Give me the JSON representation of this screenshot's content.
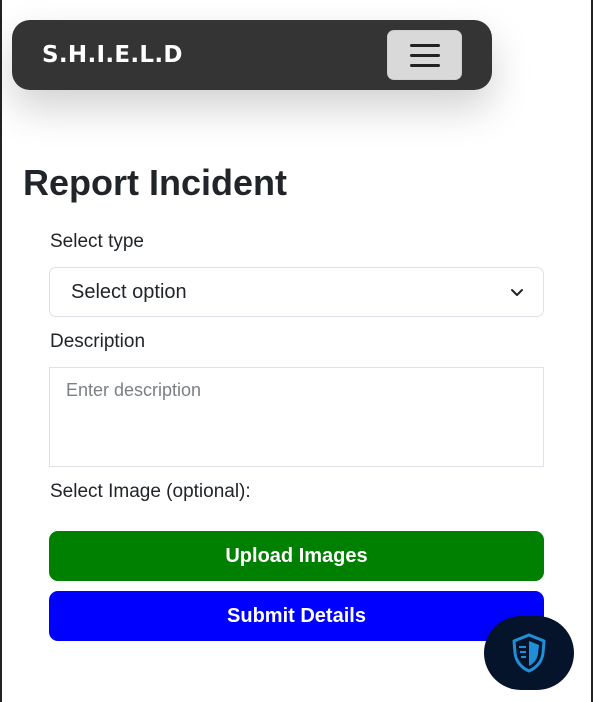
{
  "navbar": {
    "brand": "S.H.I.E.L.D",
    "toggler_icon": "hamburger-menu-icon"
  },
  "page": {
    "title": "Report Incident"
  },
  "form": {
    "type_label": "Select type",
    "type_selected": "Select option",
    "description_label": "Description",
    "description_placeholder": "Enter description",
    "description_value": "",
    "image_label": "Select Image (optional):",
    "upload_button": "Upload Images",
    "submit_button": "Submit Details"
  },
  "fab": {
    "icon": "shield-icon"
  },
  "colors": {
    "navbar_bg": "#343434",
    "upload_bg": "#008000",
    "submit_bg": "#0000ff",
    "fab_bg": "#05142a",
    "shield_accent": "#1e8fd8"
  }
}
